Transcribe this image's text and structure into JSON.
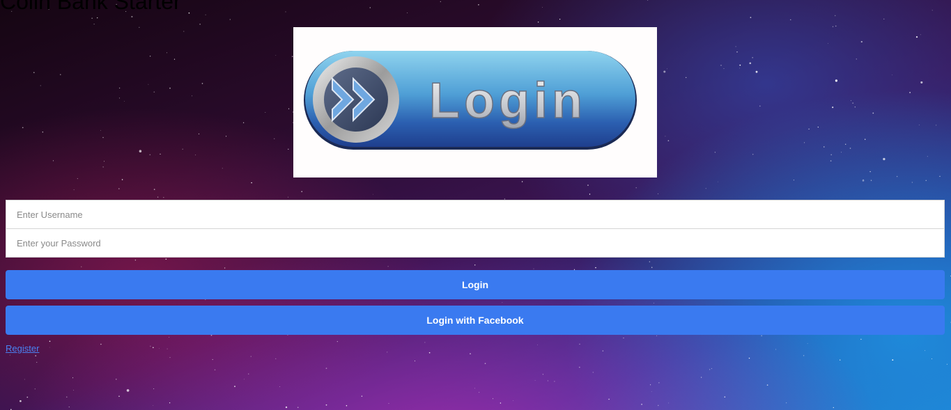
{
  "header": {
    "partial_title": "Colin Bank Starter"
  },
  "logo": {
    "text": "Login",
    "icon": "double-chevron-right-icon"
  },
  "form": {
    "username_placeholder": "Enter Username",
    "password_placeholder": "Enter your Password",
    "login_label": "Login",
    "facebook_label": "Login with Facebook",
    "register_label": "Register"
  },
  "colors": {
    "button": "#3a7af0",
    "link": "#4a82f2"
  }
}
